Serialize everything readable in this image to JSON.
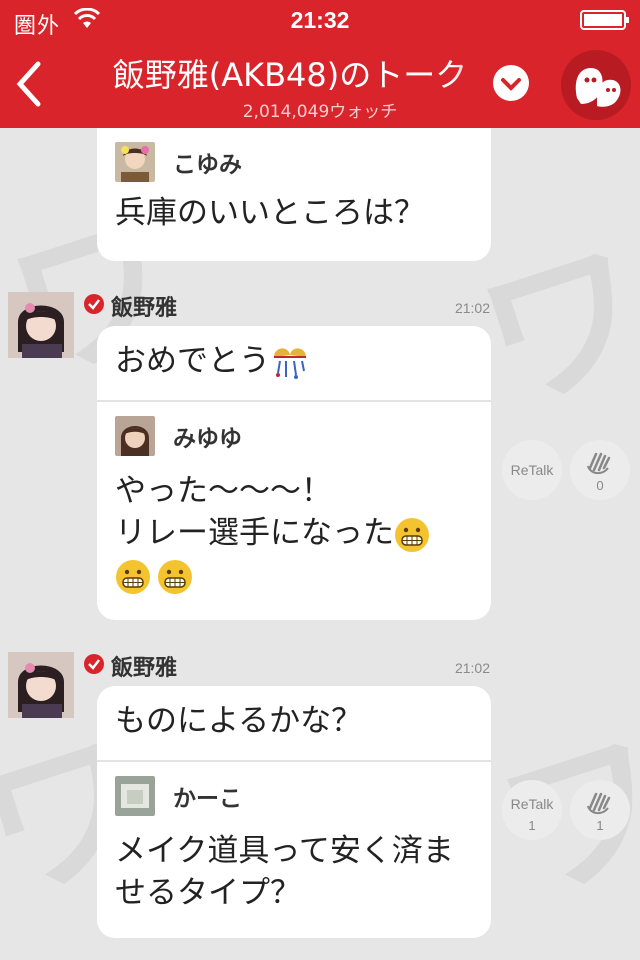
{
  "status_bar": {
    "carrier": "圏外",
    "time": "21:32"
  },
  "header": {
    "title": "飯野雅(AKB48)のトーク",
    "watch_count": "2,014,049ウォッチ",
    "accent_color": "#d8242a"
  },
  "posts": [
    {
      "quote": {
        "name": "こゆみ",
        "text": "兵庫のいいところは？"
      }
    },
    {
      "author": "飯野雅",
      "time": "21:02",
      "text": "おめでとう",
      "text_icon": "party-icon",
      "quote": {
        "name": "みゆゆ",
        "line1": "やった〜〜〜！",
        "line2": "リレー選手になった"
      },
      "retalk": {
        "label": "ReTalk",
        "count": ""
      },
      "clap": {
        "count": "0"
      }
    },
    {
      "author": "飯野雅",
      "time": "21:02",
      "text": "ものによるかな？",
      "quote": {
        "name": "かーこ",
        "line1": "メイク道具って安く済ま",
        "line2": "せるタイプ？"
      },
      "retalk": {
        "label": "ReTalk",
        "count": "1"
      },
      "clap": {
        "count": "1"
      }
    }
  ]
}
